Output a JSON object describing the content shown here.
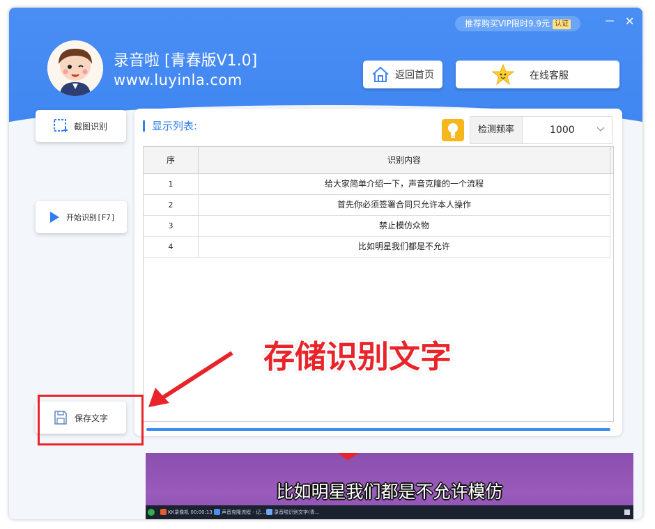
{
  "window": {
    "vip_text": "推荐购买VIP限时9.9元",
    "vip_tag": "认证",
    "minimize_glyph": "－",
    "close_glyph": "✕"
  },
  "header": {
    "app_title": "录音啦  [青春版V1.0]",
    "app_url": "www.luyinla.com",
    "home_label": "返回首页",
    "service_label": "在线客服"
  },
  "sidebar": {
    "capture_label": "截图识别",
    "start_label": "开始识别[F7]",
    "save_label": "保存文字"
  },
  "panel": {
    "title": "显示列表:",
    "freq_label": "检测频率",
    "freq_value": "1000",
    "columns": [
      "序",
      "识别内容"
    ],
    "rows": [
      {
        "seq": "1",
        "content": "给大家简单介绍一下，声音克隆的一个流程"
      },
      {
        "seq": "2",
        "content": "首先你必须签署合同只允许本人操作"
      },
      {
        "seq": "3",
        "content": "禁止模仿众物"
      },
      {
        "seq": "4",
        "content": "比如明星我们都是不允许"
      }
    ],
    "progress": 1.0
  },
  "annotation": {
    "text": "存储识别文字",
    "color": "#e8242a"
  },
  "preview": {
    "subtitle": "比如明星我们都是不允许模仿",
    "taskbar_items": [
      "KK录像机 00:00:13",
      "声音克隆流程 - 记...",
      "录音啦识别文字(青..."
    ]
  },
  "colors": {
    "accent": "#3f86f1",
    "title_blue": "#2f7ef0",
    "highlight_red": "#e8242a"
  },
  "icons": {
    "home": "home-icon",
    "service": "star-face-icon",
    "capture": "screenshot-crop-icon",
    "start": "play-icon",
    "save": "floppy-disk-icon",
    "bulb": "lightbulb-icon",
    "dropdown": "chevron-down-icon"
  }
}
